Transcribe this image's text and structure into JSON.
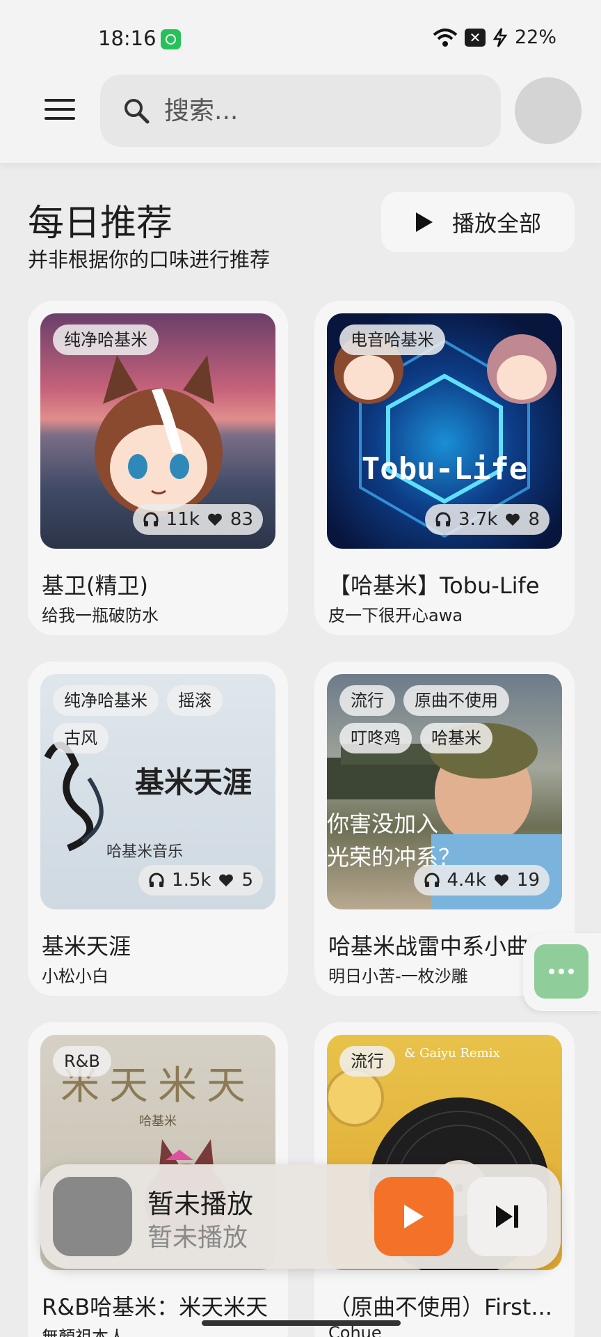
{
  "status_bar": {
    "time": "18:16",
    "battery": "22%"
  },
  "header": {
    "search_placeholder": "搜索..."
  },
  "section": {
    "title": "每日推荐",
    "subtitle": "并非根据你的口味进行推荐",
    "play_all_label": "播放全部"
  },
  "cards": [
    {
      "tags": [
        "纯净哈基米"
      ],
      "plays": "11k",
      "likes": "83",
      "title": "基卫(精卫)",
      "author": "给我一瓶破防水"
    },
    {
      "tags": [
        "电音哈基米"
      ],
      "plays": "3.7k",
      "likes": "8",
      "title": "【哈基米】Tobu-Life",
      "author": "皮一下很开心awa",
      "cover_text": "Tobu-Life"
    },
    {
      "tags": [
        "纯净哈基米",
        "摇滚",
        "古风"
      ],
      "plays": "1.5k",
      "likes": "5",
      "title": "基米天涯",
      "author": "小松小白",
      "cover_text": "基米天涯",
      "cover_subtext": "哈基米音乐"
    },
    {
      "tags": [
        "流行",
        "原曲不使用",
        "叮咚鸡",
        "哈基米"
      ],
      "plays": "4.4k",
      "likes": "19",
      "title": "哈基米战雷中系小曲",
      "author": "明日小苦-一枚沙雕",
      "cover_text": "你害没加入",
      "cover_text2": "光荣的冲系？"
    },
    {
      "tags": [
        "R&B"
      ],
      "title": "R&B哈基米：米天米天",
      "author": "無顏祖本人",
      "cover_text": "米天米天",
      "cover_subtext": "哈基米"
    },
    {
      "tags": [
        "流行"
      ],
      "title": "（原曲不使用）First...",
      "author": "Cohue",
      "cover_text": "& Gaiyu Remix"
    }
  ],
  "player": {
    "title": "暂未播放",
    "subtitle": "暂未播放"
  },
  "colors": {
    "accent": "#f37228",
    "float": "#8fce9a"
  }
}
